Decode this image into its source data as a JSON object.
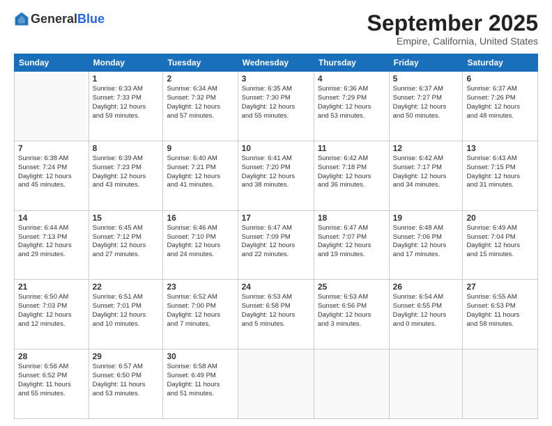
{
  "header": {
    "logo_general": "General",
    "logo_blue": "Blue",
    "month": "September 2025",
    "location": "Empire, California, United States"
  },
  "weekdays": [
    "Sunday",
    "Monday",
    "Tuesday",
    "Wednesday",
    "Thursday",
    "Friday",
    "Saturday"
  ],
  "weeks": [
    [
      {
        "num": "",
        "info": ""
      },
      {
        "num": "1",
        "info": "Sunrise: 6:33 AM\nSunset: 7:33 PM\nDaylight: 12 hours\nand 59 minutes."
      },
      {
        "num": "2",
        "info": "Sunrise: 6:34 AM\nSunset: 7:32 PM\nDaylight: 12 hours\nand 57 minutes."
      },
      {
        "num": "3",
        "info": "Sunrise: 6:35 AM\nSunset: 7:30 PM\nDaylight: 12 hours\nand 55 minutes."
      },
      {
        "num": "4",
        "info": "Sunrise: 6:36 AM\nSunset: 7:29 PM\nDaylight: 12 hours\nand 53 minutes."
      },
      {
        "num": "5",
        "info": "Sunrise: 6:37 AM\nSunset: 7:27 PM\nDaylight: 12 hours\nand 50 minutes."
      },
      {
        "num": "6",
        "info": "Sunrise: 6:37 AM\nSunset: 7:26 PM\nDaylight: 12 hours\nand 48 minutes."
      }
    ],
    [
      {
        "num": "7",
        "info": "Sunrise: 6:38 AM\nSunset: 7:24 PM\nDaylight: 12 hours\nand 45 minutes."
      },
      {
        "num": "8",
        "info": "Sunrise: 6:39 AM\nSunset: 7:23 PM\nDaylight: 12 hours\nand 43 minutes."
      },
      {
        "num": "9",
        "info": "Sunrise: 6:40 AM\nSunset: 7:21 PM\nDaylight: 12 hours\nand 41 minutes."
      },
      {
        "num": "10",
        "info": "Sunrise: 6:41 AM\nSunset: 7:20 PM\nDaylight: 12 hours\nand 38 minutes."
      },
      {
        "num": "11",
        "info": "Sunrise: 6:42 AM\nSunset: 7:18 PM\nDaylight: 12 hours\nand 36 minutes."
      },
      {
        "num": "12",
        "info": "Sunrise: 6:42 AM\nSunset: 7:17 PM\nDaylight: 12 hours\nand 34 minutes."
      },
      {
        "num": "13",
        "info": "Sunrise: 6:43 AM\nSunset: 7:15 PM\nDaylight: 12 hours\nand 31 minutes."
      }
    ],
    [
      {
        "num": "14",
        "info": "Sunrise: 6:44 AM\nSunset: 7:13 PM\nDaylight: 12 hours\nand 29 minutes."
      },
      {
        "num": "15",
        "info": "Sunrise: 6:45 AM\nSunset: 7:12 PM\nDaylight: 12 hours\nand 27 minutes."
      },
      {
        "num": "16",
        "info": "Sunrise: 6:46 AM\nSunset: 7:10 PM\nDaylight: 12 hours\nand 24 minutes."
      },
      {
        "num": "17",
        "info": "Sunrise: 6:47 AM\nSunset: 7:09 PM\nDaylight: 12 hours\nand 22 minutes."
      },
      {
        "num": "18",
        "info": "Sunrise: 6:47 AM\nSunset: 7:07 PM\nDaylight: 12 hours\nand 19 minutes."
      },
      {
        "num": "19",
        "info": "Sunrise: 6:48 AM\nSunset: 7:06 PM\nDaylight: 12 hours\nand 17 minutes."
      },
      {
        "num": "20",
        "info": "Sunrise: 6:49 AM\nSunset: 7:04 PM\nDaylight: 12 hours\nand 15 minutes."
      }
    ],
    [
      {
        "num": "21",
        "info": "Sunrise: 6:50 AM\nSunset: 7:03 PM\nDaylight: 12 hours\nand 12 minutes."
      },
      {
        "num": "22",
        "info": "Sunrise: 6:51 AM\nSunset: 7:01 PM\nDaylight: 12 hours\nand 10 minutes."
      },
      {
        "num": "23",
        "info": "Sunrise: 6:52 AM\nSunset: 7:00 PM\nDaylight: 12 hours\nand 7 minutes."
      },
      {
        "num": "24",
        "info": "Sunrise: 6:53 AM\nSunset: 6:58 PM\nDaylight: 12 hours\nand 5 minutes."
      },
      {
        "num": "25",
        "info": "Sunrise: 6:53 AM\nSunset: 6:56 PM\nDaylight: 12 hours\nand 3 minutes."
      },
      {
        "num": "26",
        "info": "Sunrise: 6:54 AM\nSunset: 6:55 PM\nDaylight: 12 hours\nand 0 minutes."
      },
      {
        "num": "27",
        "info": "Sunrise: 6:55 AM\nSunset: 6:53 PM\nDaylight: 11 hours\nand 58 minutes."
      }
    ],
    [
      {
        "num": "28",
        "info": "Sunrise: 6:56 AM\nSunset: 6:52 PM\nDaylight: 11 hours\nand 55 minutes."
      },
      {
        "num": "29",
        "info": "Sunrise: 6:57 AM\nSunset: 6:50 PM\nDaylight: 11 hours\nand 53 minutes."
      },
      {
        "num": "30",
        "info": "Sunrise: 6:58 AM\nSunset: 6:49 PM\nDaylight: 11 hours\nand 51 minutes."
      },
      {
        "num": "",
        "info": ""
      },
      {
        "num": "",
        "info": ""
      },
      {
        "num": "",
        "info": ""
      },
      {
        "num": "",
        "info": ""
      }
    ]
  ]
}
